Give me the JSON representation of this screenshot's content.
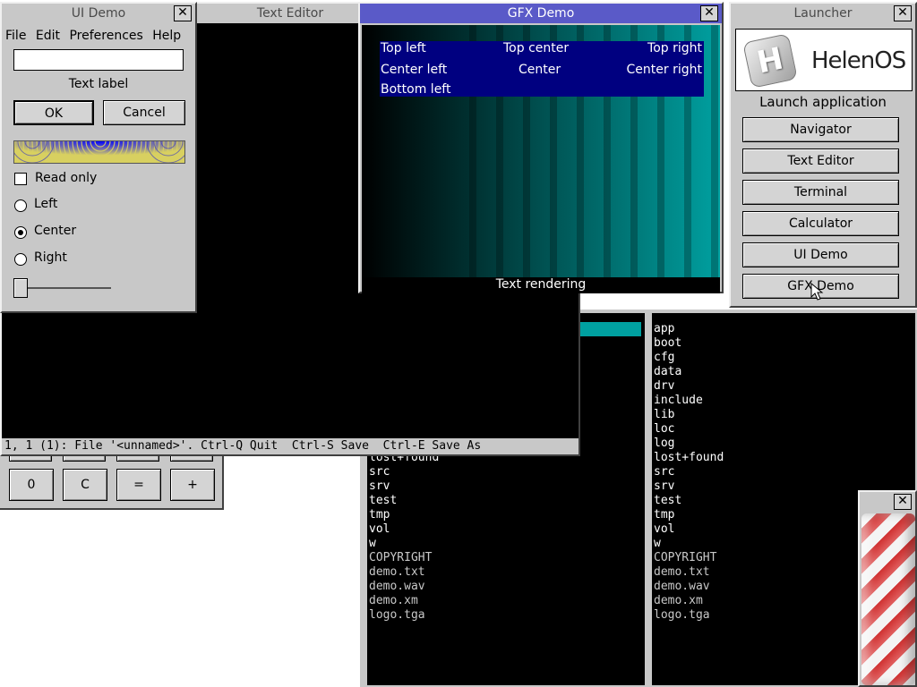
{
  "navigator": {
    "left_entries_dirs": [
      "lost+found",
      "src",
      "srv",
      "test",
      "tmp",
      "vol",
      "w"
    ],
    "left_entries_files": [
      "COPYRIGHT",
      "demo.txt",
      "demo.wav",
      "demo.xm",
      "logo.tga"
    ],
    "right_entries_dirs": [
      "app",
      "boot",
      "cfg",
      "data",
      "drv",
      "include",
      "lib",
      "loc",
      "log",
      "lost+found",
      "src",
      "srv",
      "test",
      "tmp",
      "vol",
      "w"
    ],
    "right_entries_files": [
      "COPYRIGHT",
      "demo.txt",
      "demo.wav",
      "demo.xm",
      "logo.tga"
    ]
  },
  "calculator": {
    "keys": [
      "0",
      "C",
      "=",
      "+"
    ]
  },
  "text_editor": {
    "title": "Text Editor",
    "status": "1, 1 (1): File '<unnamed>'. Ctrl-Q Quit  Ctrl-S Save  Ctrl-E Save As"
  },
  "ui_demo": {
    "title": "UI Demo",
    "menu": [
      "File",
      "Edit",
      "Preferences",
      "Help"
    ],
    "entry_value": "",
    "label": "Text label",
    "ok": "OK",
    "cancel": "Cancel",
    "checkbox_label": "Read only",
    "checkbox_checked": false,
    "radios": [
      {
        "label": "Left",
        "selected": false
      },
      {
        "label": "Center",
        "selected": true
      },
      {
        "label": "Right",
        "selected": false
      }
    ],
    "slider_value": 0
  },
  "gfx_demo": {
    "title": "GFX Demo",
    "labels": {
      "top_left": "Top left",
      "top_center": "Top center",
      "top_right": "Top right",
      "center_left": "Center left",
      "center": "Center",
      "center_right": "Center right",
      "bottom_left": "Bottom left"
    },
    "caption": "Text rendering"
  },
  "launcher": {
    "title": "Launcher",
    "logo_text": "HelenOS",
    "logo_letter": "H",
    "heading": "Launch application",
    "apps": [
      "Navigator",
      "Text Editor",
      "Terminal",
      "Calculator",
      "UI Demo",
      "GFX Demo"
    ]
  },
  "barber": {
    "close": "✕"
  },
  "colors": {
    "active_title": "#5a5ac8",
    "gfx_text_bg": "#000080",
    "teal": "#00a0a0"
  }
}
